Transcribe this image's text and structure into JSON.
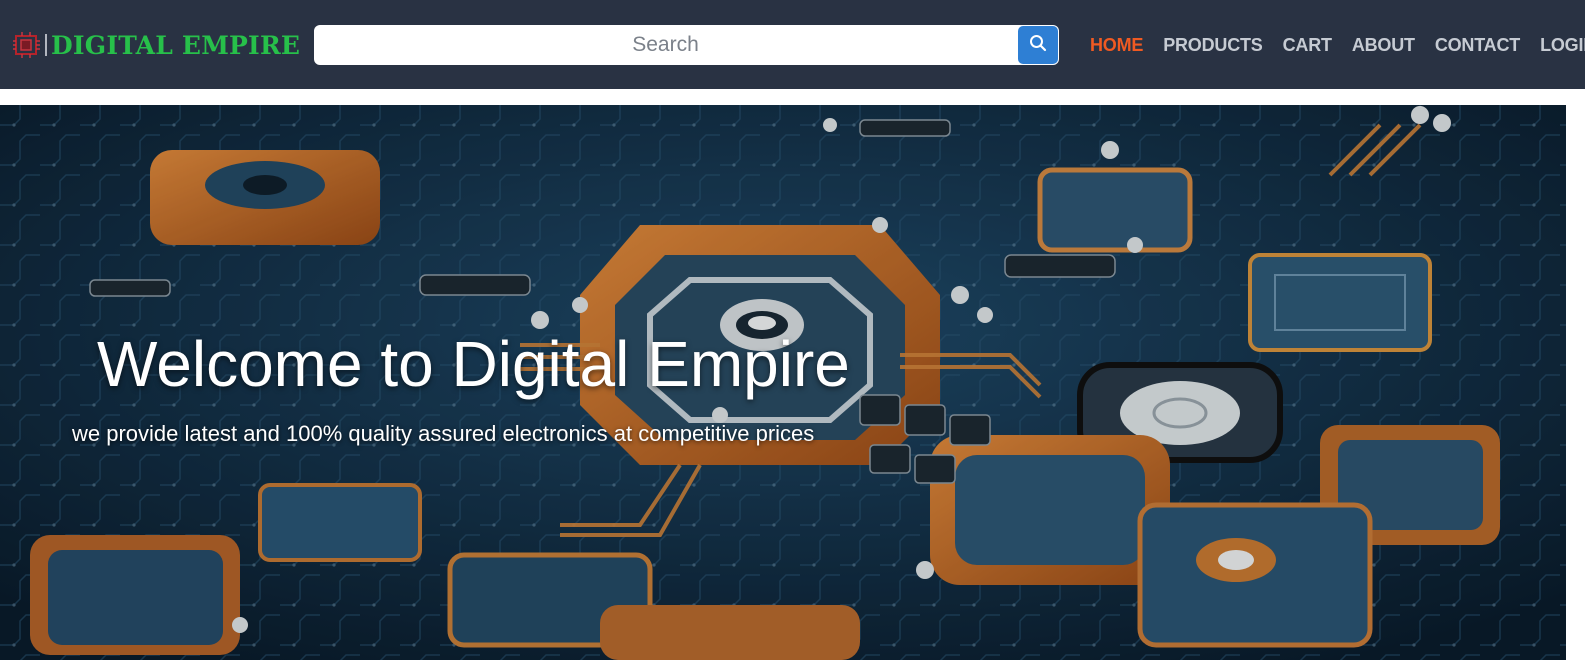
{
  "navbar": {
    "brand_name": "DIGITAL EMPIRE",
    "brand_icon": "circuit-chip-logo-icon",
    "brand_color": "#27c04a",
    "background_color": "#293243",
    "search": {
      "placeholder": "Search",
      "value": "",
      "button_icon": "search-icon",
      "button_color": "#2e7fd4"
    },
    "links": [
      {
        "label": "HOME",
        "active": true
      },
      {
        "label": "PRODUCTS",
        "active": false
      },
      {
        "label": "CART",
        "active": false
      },
      {
        "label": "ABOUT",
        "active": false
      },
      {
        "label": "CONTACT",
        "active": false
      },
      {
        "label": "LOGIN",
        "active": false
      }
    ],
    "active_link_color": "#f05a22"
  },
  "hero": {
    "title": "Welcome to Digital Empire",
    "subtitle": "we provide latest and 100% quality assured electronics at competitive prices",
    "background_image": "circuit-board-motherboard-photo"
  }
}
